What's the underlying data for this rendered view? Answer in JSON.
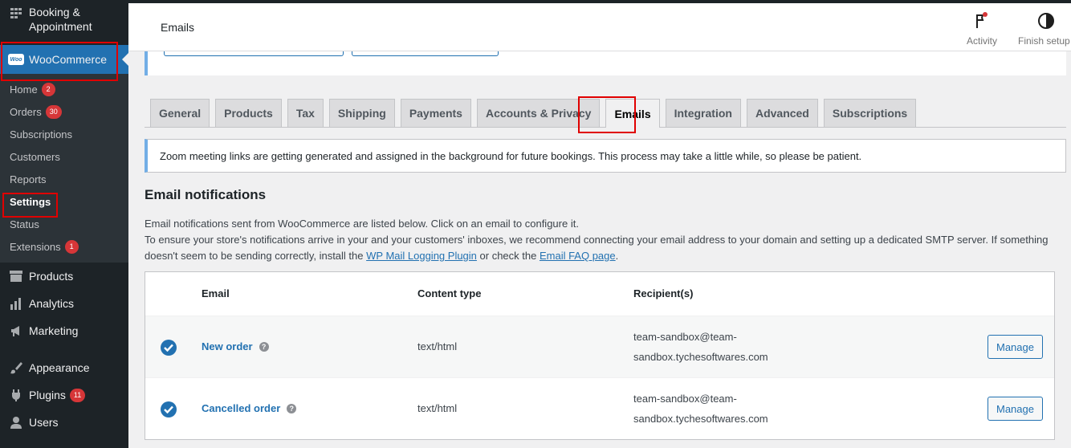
{
  "sidebar": {
    "booking_label_1": "Booking &",
    "booking_label_2": "Appointment",
    "woocommerce_label": "WooCommerce",
    "woo_logo_text": "Woo",
    "submenu": [
      {
        "label": "Home",
        "count": "2"
      },
      {
        "label": "Orders",
        "count": "30"
      },
      {
        "label": "Subscriptions"
      },
      {
        "label": "Customers"
      },
      {
        "label": "Reports"
      },
      {
        "label": "Settings"
      },
      {
        "label": "Status"
      },
      {
        "label": "Extensions",
        "count": "1"
      }
    ],
    "menu": [
      {
        "label": "Products",
        "icon": "products-icon"
      },
      {
        "label": "Analytics",
        "icon": "analytics-icon"
      },
      {
        "label": "Marketing",
        "icon": "marketing-icon"
      },
      {
        "label": "Appearance",
        "icon": "appearance-icon"
      },
      {
        "label": "Plugins",
        "icon": "plugins-icon",
        "count": "11"
      },
      {
        "label": "Users",
        "icon": "users-icon"
      }
    ]
  },
  "header": {
    "title": "Emails",
    "activity_label": "Activity",
    "finish_setup_label": "Finish setup"
  },
  "tabs": [
    "General",
    "Products",
    "Tax",
    "Shipping",
    "Payments",
    "Accounts & Privacy",
    "Emails",
    "Integration",
    "Advanced",
    "Subscriptions"
  ],
  "active_tab": "Emails",
  "notice": "Zoom meeting links are getting generated and assigned in the background for future bookings. This process may take a little while, so please be patient.",
  "section": {
    "title": "Email notifications",
    "desc_line1": "Email notifications sent from WooCommerce are listed below. Click on an email to configure it.",
    "desc_line2_a": "To ensure your store's notifications arrive in your and your customers' inboxes, we recommend connecting your email address to your domain and setting up a dedicated SMTP server. If something doesn't seem to be sending correctly, install the ",
    "desc_link1": "WP Mail Logging Plugin",
    "desc_line2_b": " or check the ",
    "desc_link2": "Email FAQ page",
    "desc_line2_c": "."
  },
  "table": {
    "headers": {
      "email": "Email",
      "content_type": "Content type",
      "recipients": "Recipient(s)"
    },
    "rows": [
      {
        "name": "New order",
        "type": "text/html",
        "recip1": "team-sandbox@team-",
        "recip2": "sandbox.tychesoftwares.com",
        "action": "Manage"
      },
      {
        "name": "Cancelled order",
        "type": "text/html",
        "recip1": "team-sandbox@team-",
        "recip2": "sandbox.tychesoftwares.com",
        "action": "Manage"
      }
    ]
  },
  "colors": {
    "accent": "#2271b1",
    "sidebar": "#1d2327",
    "highlight": "#e00000",
    "badge": "#d63638"
  }
}
